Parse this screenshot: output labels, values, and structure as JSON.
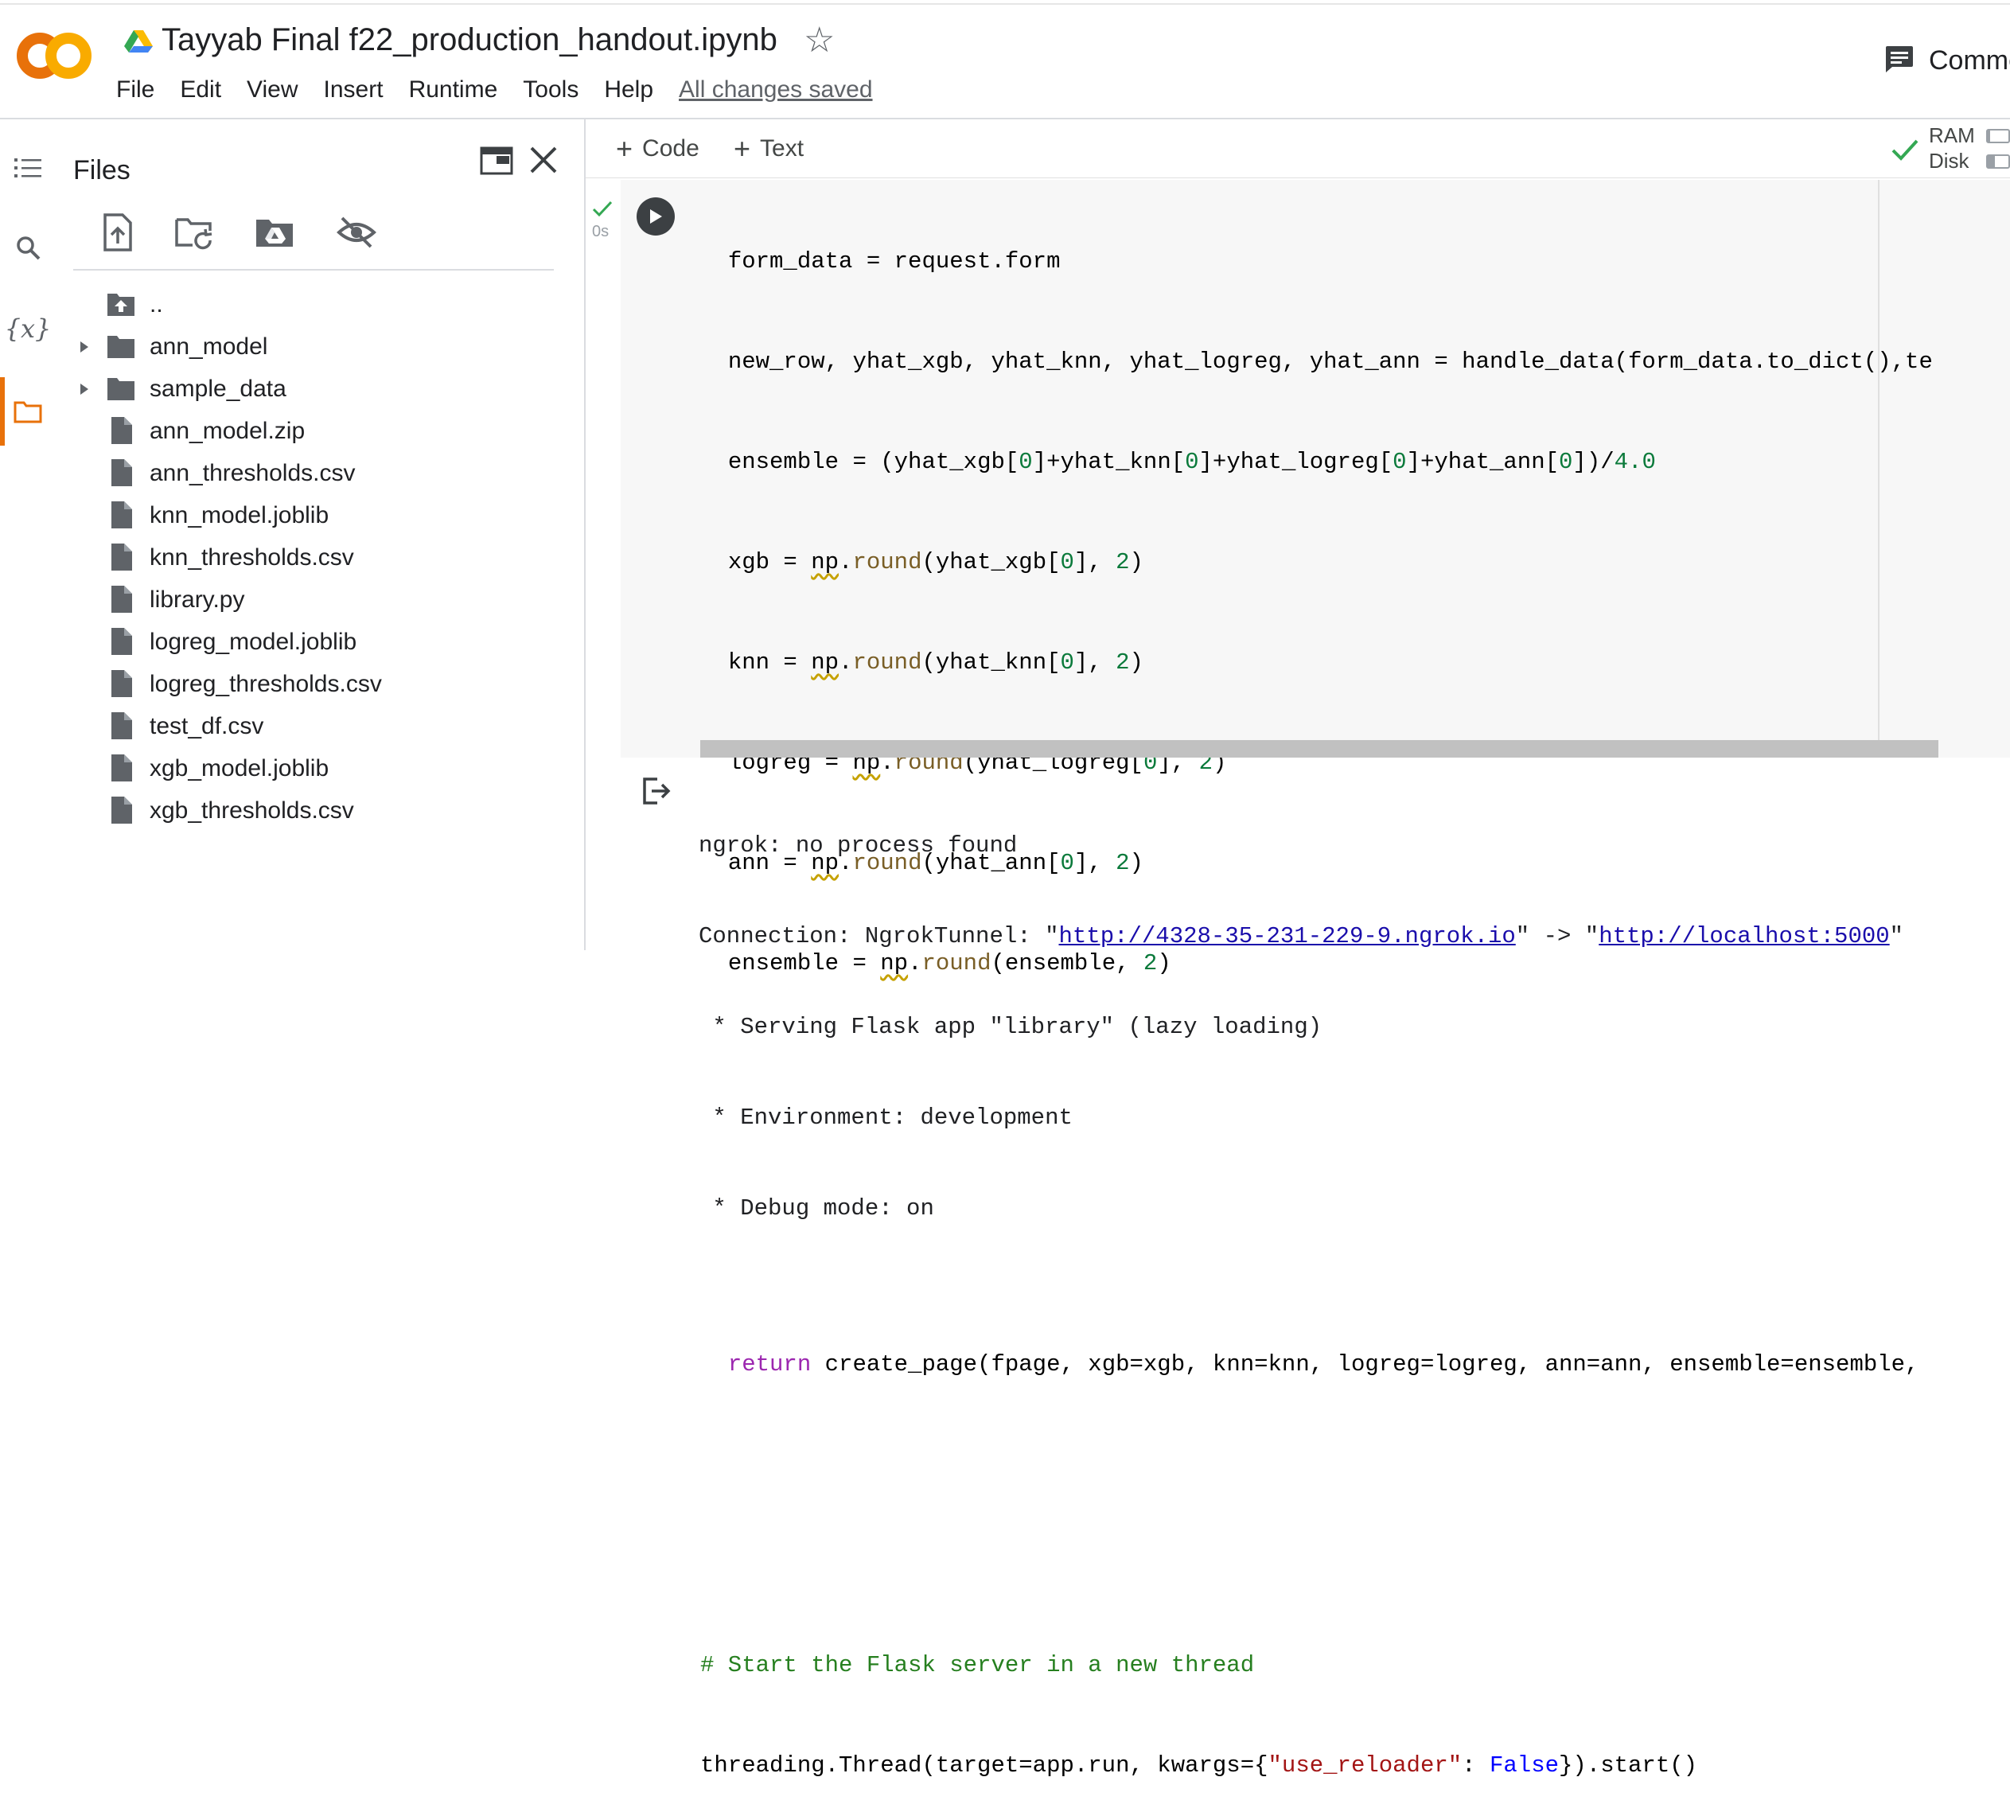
{
  "header": {
    "title": "Tayyab Final f22_production_handout.ipynb",
    "logo_text": "CO",
    "menu": [
      "File",
      "Edit",
      "View",
      "Insert",
      "Runtime",
      "Tools",
      "Help"
    ],
    "save_status": "All changes saved",
    "comment_label": "Comme"
  },
  "rail": {
    "icons": [
      "table-of-contents-icon",
      "search-icon",
      "variables-icon",
      "files-icon"
    ],
    "variables_glyph": "{x}",
    "active": "files-icon"
  },
  "files": {
    "title": "Files",
    "toolbar": [
      "upload-file-icon",
      "refresh-icon",
      "mount-drive-icon",
      "hide-icon"
    ],
    "items": [
      {
        "name": "..",
        "type": "parent"
      },
      {
        "name": "ann_model",
        "type": "folder"
      },
      {
        "name": "sample_data",
        "type": "folder"
      },
      {
        "name": "ann_model.zip",
        "type": "file"
      },
      {
        "name": "ann_thresholds.csv",
        "type": "file"
      },
      {
        "name": "knn_model.joblib",
        "type": "file"
      },
      {
        "name": "knn_thresholds.csv",
        "type": "file"
      },
      {
        "name": "library.py",
        "type": "file"
      },
      {
        "name": "logreg_model.joblib",
        "type": "file"
      },
      {
        "name": "logreg_thresholds.csv",
        "type": "file"
      },
      {
        "name": "test_df.csv",
        "type": "file"
      },
      {
        "name": "xgb_model.joblib",
        "type": "file"
      },
      {
        "name": "xgb_thresholds.csv",
        "type": "file"
      }
    ]
  },
  "toolbar": {
    "code_label": "Code",
    "text_label": "Text",
    "ram_label": "RAM",
    "disk_label": "Disk",
    "ram_usage": 0.12,
    "disk_usage": 0.35
  },
  "cell": {
    "exec_time": "0s",
    "lines": [
      "form_data = request.form",
      "new_row, yhat_xgb, yhat_knn, yhat_logreg, yhat_ann = handle_data(form_data.to_dict(),te",
      "ensemble = (yhat_xgb[0]+yhat_knn[0]+yhat_logreg[0]+yhat_ann[0])/4.0",
      "xgb = np.round(yhat_xgb[0], 2)",
      "knn = np.round(yhat_knn[0], 2)",
      "logreg = np.round(yhat_logreg[0], 2)",
      "ann = np.round(yhat_ann[0], 2)",
      "ensemble = np.round(ensemble, 2)",
      "",
      "",
      "",
      "return create_page(fpage, xgb=xgb, knn=knn, logreg=logreg, ann=ann, ensemble=ensemble,",
      "",
      "",
      "# Start the Flask server in a new thread",
      "threading.Thread(target=app.run, kwargs={\"use_reloader\": False}).start()"
    ]
  },
  "output": {
    "line1": "ngrok: no process found",
    "conn_prefix": "Connection: NgrokTunnel: \"",
    "conn_url1": "http://4328-35-231-229-9.ngrok.io",
    "conn_mid": "\" -> \"",
    "conn_url2": "http://localhost:5000",
    "conn_suffix": "\"",
    "line3": " * Serving Flask app \"library\" (lazy loading)",
    "line4": " * Environment: development",
    "line5": " * Debug mode: on"
  },
  "colors": {
    "logo_orange": "#f9ab00",
    "logo_dark_orange": "#e8710a",
    "keyword": "#9c27b0",
    "number": "#0b7a3b",
    "string": "#a31515",
    "comment": "#267f1f",
    "function": "#795e26",
    "boolean": "#0000ff",
    "link": "#1a0dab"
  }
}
